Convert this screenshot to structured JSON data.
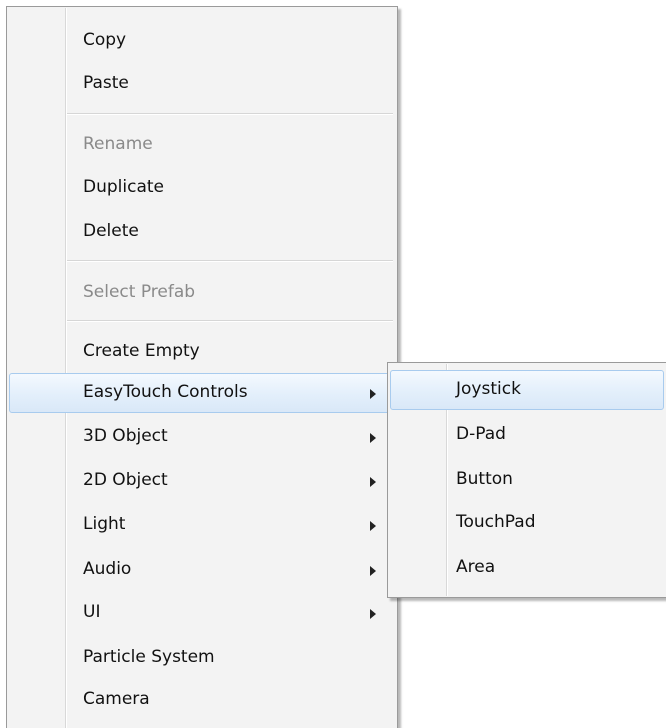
{
  "menu": {
    "items": [
      {
        "label": "Copy",
        "disabled": false
      },
      {
        "label": "Paste",
        "disabled": false
      },
      {
        "label": "Rename",
        "disabled": true
      },
      {
        "label": "Duplicate",
        "disabled": false
      },
      {
        "label": "Delete",
        "disabled": false
      },
      {
        "label": "Select Prefab",
        "disabled": true
      },
      {
        "label": "Create Empty",
        "disabled": false
      },
      {
        "label": "EasyTouch Controls",
        "disabled": false,
        "has_submenu": true,
        "highlighted": true
      },
      {
        "label": "3D Object",
        "disabled": false,
        "has_submenu": true
      },
      {
        "label": "2D Object",
        "disabled": false,
        "has_submenu": true
      },
      {
        "label": "Light",
        "disabled": false,
        "has_submenu": true
      },
      {
        "label": "Audio",
        "disabled": false,
        "has_submenu": true
      },
      {
        "label": "UI",
        "disabled": false,
        "has_submenu": true
      },
      {
        "label": "Particle System",
        "disabled": false
      },
      {
        "label": "Camera",
        "disabled": false
      }
    ]
  },
  "submenu": {
    "items": [
      {
        "label": "Joystick",
        "highlighted": true
      },
      {
        "label": "D-Pad"
      },
      {
        "label": "Button"
      },
      {
        "label": "TouchPad"
      },
      {
        "label": "Area"
      }
    ]
  },
  "colors": {
    "menu_background": "#f3f3f3",
    "highlight_border": "#a8cbee",
    "highlight_fill": "#e3effb",
    "disabled_text": "#8a8a8a",
    "text": "#111111"
  },
  "icons": {
    "submenu_arrow": "submenu-arrow-icon"
  }
}
